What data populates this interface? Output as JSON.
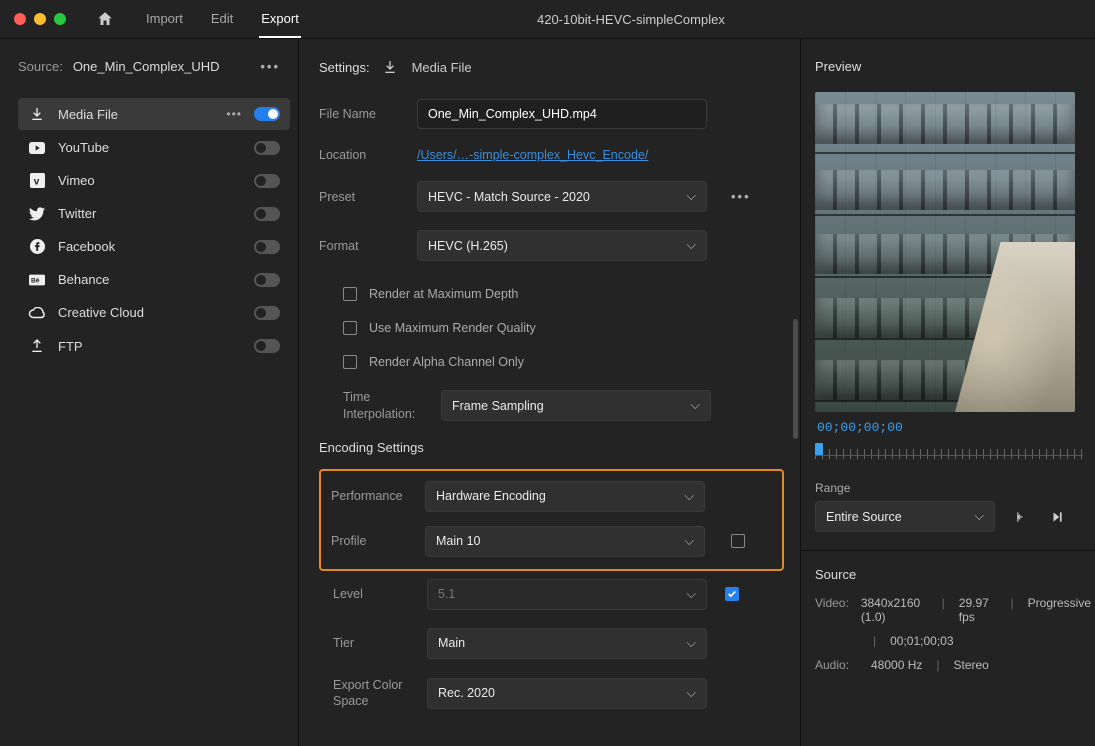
{
  "titlebar": {
    "tabs": {
      "import": "Import",
      "edit": "Edit",
      "export": "Export"
    },
    "window_title": "420-10bit-HEVC-simpleComplex"
  },
  "left": {
    "source_label": "Source:",
    "source_value": "One_Min_Complex_UHD",
    "destinations": [
      {
        "name": "Media File",
        "toggle": true,
        "active": true,
        "kebab": true
      },
      {
        "name": "YouTube",
        "toggle": false
      },
      {
        "name": "Vimeo",
        "toggle": false
      },
      {
        "name": "Twitter",
        "toggle": false
      },
      {
        "name": "Facebook",
        "toggle": false
      },
      {
        "name": "Behance",
        "toggle": false
      },
      {
        "name": "Creative Cloud",
        "toggle": false
      },
      {
        "name": "FTP",
        "toggle": false
      }
    ]
  },
  "center": {
    "settings_label": "Settings:",
    "settings_target": "Media File",
    "file_name_label": "File Name",
    "file_name_value": "One_Min_Complex_UHD.mp4",
    "location_label": "Location",
    "location_value": "/Users/…-simple-complex_Hevc_Encode/",
    "preset_label": "Preset",
    "preset_value": "HEVC - Match Source - 2020",
    "format_label": "Format",
    "format_value": "HEVC (H.265)",
    "chk_max_depth": "Render at Maximum Depth",
    "chk_max_quality": "Use Maximum Render Quality",
    "chk_alpha_only": "Render Alpha Channel Only",
    "time_interp_label": "Time Interpolation:",
    "time_interp_value": "Frame Sampling",
    "encoding_header": "Encoding Settings",
    "performance_label": "Performance",
    "performance_value": "Hardware Encoding",
    "profile_label": "Profile",
    "profile_value": "Main 10",
    "level_label": "Level",
    "level_value": "5.1",
    "tier_label": "Tier",
    "tier_value": "Main",
    "color_space_label": "Export Color Space",
    "color_space_value": "Rec. 2020"
  },
  "right": {
    "preview_label": "Preview",
    "timecode": "00;00;00;00",
    "range_label": "Range",
    "range_value": "Entire Source",
    "source_label": "Source",
    "video_label": "Video:",
    "video_value_1": "3840x2160 (1.0)",
    "video_value_2": "29.97 fps",
    "video_value_3": "Progressive",
    "video_value_4": "00;01;00;03",
    "audio_label": "Audio:",
    "audio_value_1": "48000 Hz",
    "audio_value_2": "Stereo"
  }
}
